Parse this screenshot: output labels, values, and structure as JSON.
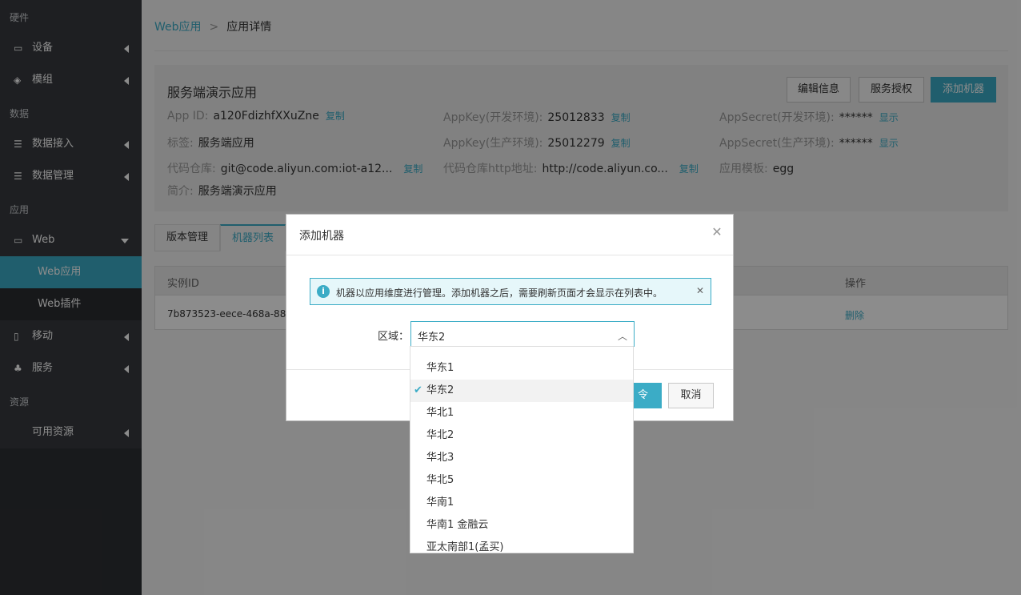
{
  "sidebar": {
    "sections": {
      "hardware": "硬件",
      "data": "数据",
      "app": "应用",
      "resource": "资源"
    },
    "items": {
      "device": "设备",
      "module": "模组",
      "data_access": "数据接入",
      "data_manage": "数据管理",
      "web": "Web",
      "web_app": "Web应用",
      "web_plugin": "Web插件",
      "mobile": "移动",
      "service": "服务",
      "available_resource": "可用资源"
    }
  },
  "breadcrumb": {
    "parent": "Web应用",
    "separator": ">",
    "current": "应用详情"
  },
  "app": {
    "title": "服务端演示应用",
    "buttons": {
      "edit": "编辑信息",
      "authorize": "服务授权",
      "add_machine": "添加机器"
    },
    "fields": {
      "app_id_label": "App ID:",
      "app_id": "a120FdizhfXXuZne",
      "app_id_action": "复制",
      "appkey_dev_label": "AppKey(开发环境):",
      "appkey_dev": "25012833",
      "appkey_dev_action": "复制",
      "appsecret_dev_label": "AppSecret(开发环境):",
      "appsecret_dev": "******",
      "appsecret_dev_action": "显示",
      "tag_label": "标签:",
      "tag": "服务端应用",
      "appkey_prod_label": "AppKey(生产环境):",
      "appkey_prod": "25012279",
      "appkey_prod_action": "复制",
      "appsecret_prod_label": "AppSecret(生产环境):",
      "appsecret_prod": "******",
      "appsecret_prod_action": "显示",
      "repo_label": "代码仓库:",
      "repo": "git@code.aliyun.com:iot-a12...",
      "repo_action": "复制",
      "repo_http_label": "代码仓库http地址:",
      "repo_http": "http://code.aliyun.co...",
      "repo_http_action": "复制",
      "template_label": "应用模板:",
      "template": "egg",
      "intro_label": "简介:",
      "intro": "服务端演示应用"
    }
  },
  "tabs": {
    "version": "版本管理",
    "machines": "机器列表"
  },
  "table": {
    "headers": {
      "instance_id": "实例ID",
      "action": "操作"
    },
    "row": {
      "instance_id": "7b873523-eece-468a-8800-",
      "action": "删除"
    }
  },
  "modal": {
    "title": "添加机器",
    "alert": "机器以应用维度进行管理。添加机器之后，需要刷新页面才会显示在列表中。",
    "region_label": "区域：",
    "region_value": "华东2",
    "confirm_partial": "令",
    "cancel": "取消"
  },
  "dropdown": {
    "options": [
      "华东1",
      "华东2",
      "华北1",
      "华北2",
      "华北3",
      "华北5",
      "华南1",
      "华南1 金融云",
      "亚太南部1(孟买)"
    ],
    "selected_index": 1
  },
  "colors": {
    "accent": "#3bacc6",
    "sidebar": "#37393e",
    "sidebar_active": "#3bacc6"
  }
}
